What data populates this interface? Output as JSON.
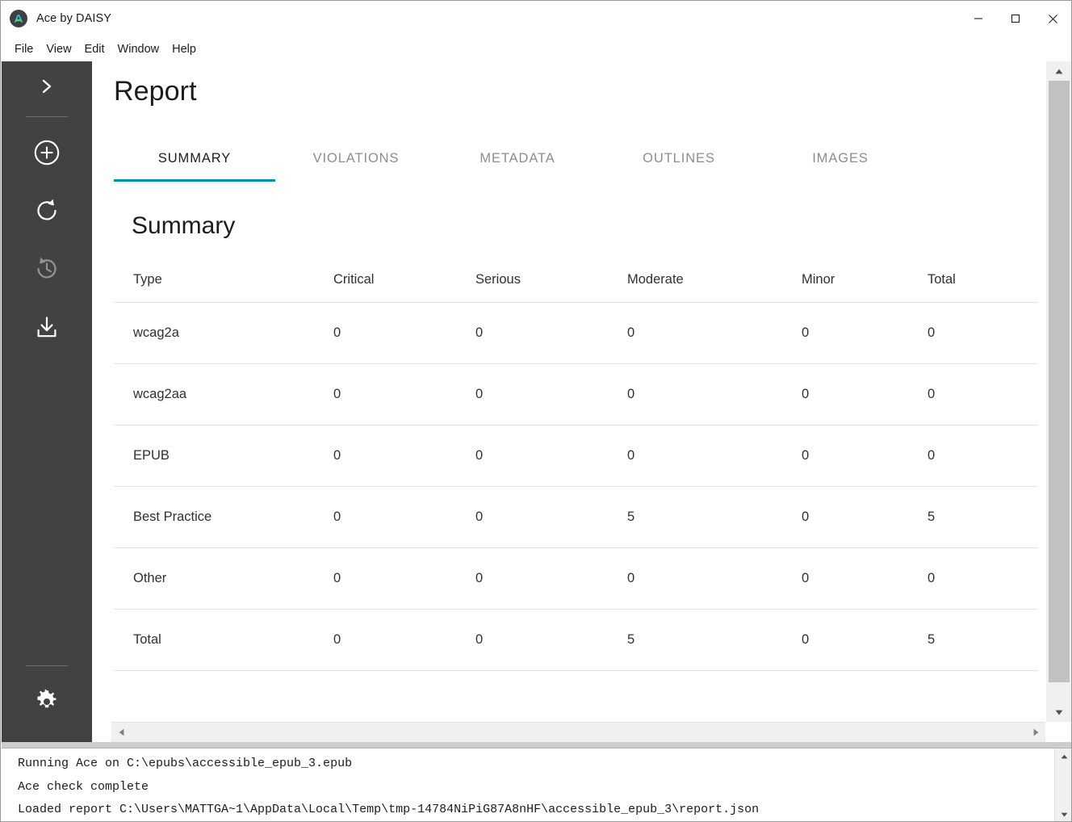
{
  "window": {
    "title": "Ace by DAISY",
    "logo_icon": "ace-daisy-logo-icon",
    "controls": {
      "minimize": "minimize-icon",
      "maximize": "maximize-icon",
      "close": "close-icon"
    }
  },
  "menubar": {
    "items": [
      {
        "label": "File"
      },
      {
        "label": "View"
      },
      {
        "label": "Edit"
      },
      {
        "label": "Window"
      },
      {
        "label": "Help"
      }
    ]
  },
  "sidebar": {
    "background": "#424242",
    "items": [
      {
        "name": "expand-sidebar",
        "icon": "chevron-right-icon",
        "enabled": true
      },
      {
        "name": "add-epub",
        "icon": "plus-circle-icon",
        "enabled": true
      },
      {
        "name": "recheck",
        "icon": "refresh-icon",
        "enabled": true
      },
      {
        "name": "history",
        "icon": "history-icon",
        "enabled": false
      },
      {
        "name": "download-report",
        "icon": "download-icon",
        "enabled": true
      },
      {
        "name": "preferences",
        "icon": "gear-icon",
        "enabled": true
      }
    ]
  },
  "main": {
    "page_title": "Report",
    "accent_color": "#0093a7",
    "tabs": [
      {
        "label": "SUMMARY",
        "active": true
      },
      {
        "label": "VIOLATIONS",
        "active": false
      },
      {
        "label": "METADATA",
        "active": false
      },
      {
        "label": "OUTLINES",
        "active": false
      },
      {
        "label": "IMAGES",
        "active": false
      }
    ],
    "section_title": "Summary",
    "table": {
      "headers": [
        "Type",
        "Critical",
        "Serious",
        "Moderate",
        "Minor",
        "Total"
      ],
      "rows": [
        {
          "type": "wcag2a",
          "critical": "0",
          "serious": "0",
          "moderate": "0",
          "minor": "0",
          "total": "0"
        },
        {
          "type": "wcag2aa",
          "critical": "0",
          "serious": "0",
          "moderate": "0",
          "minor": "0",
          "total": "0"
        },
        {
          "type": "EPUB",
          "critical": "0",
          "serious": "0",
          "moderate": "0",
          "minor": "0",
          "total": "0"
        },
        {
          "type": "Best Practice",
          "critical": "0",
          "serious": "0",
          "moderate": "5",
          "minor": "0",
          "total": "5"
        },
        {
          "type": "Other",
          "critical": "0",
          "serious": "0",
          "moderate": "0",
          "minor": "0",
          "total": "0"
        },
        {
          "type": "Total",
          "critical": "0",
          "serious": "0",
          "moderate": "5",
          "minor": "0",
          "total": "5"
        }
      ]
    }
  },
  "console": {
    "lines": [
      "Running Ace on C:\\epubs\\accessible_epub_3.epub",
      "Ace check complete",
      "Loaded report C:\\Users\\MATTGA~1\\AppData\\Local\\Temp\\tmp-14784NiPiG87A8nHF\\accessible_epub_3\\report.json"
    ]
  }
}
